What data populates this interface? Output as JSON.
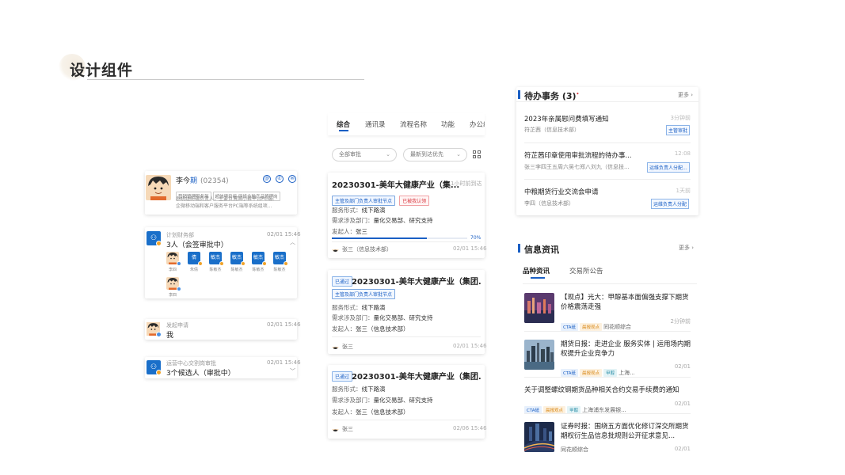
{
  "page": {
    "title": "设计组件"
  },
  "person_card": {
    "name_a": "李今",
    "name_b": "期",
    "code": "(02354)",
    "tags": [
      "营销管理服务部",
      "超体项目组-网络金融产品管理岗"
    ],
    "desc_lines": [
      "系统组前端负责人，主要负责国小君平台PC端、",
      "企微移动端和客户服务平台PC端等系统组项..."
    ],
    "actions": [
      "@",
      "✆",
      "✉"
    ]
  },
  "approvals": [
    {
      "dept": "计划财务部",
      "summary": "3人（会签审批中）",
      "date": "02/01 15:46",
      "members": [
        {
          "initial": "",
          "name": "李四"
        },
        {
          "initial": "倩",
          "name": "朱倩"
        },
        {
          "initial": "敏杰",
          "name": "陈敏杰"
        },
        {
          "initial": "敏杰",
          "name": "陈敏杰"
        },
        {
          "initial": "敏杰",
          "name": "陈敏杰"
        },
        {
          "initial": "敏杰",
          "name": "陈敏杰"
        },
        {
          "initial": "",
          "name": "李四"
        }
      ]
    },
    {
      "dept": "发起申请",
      "summary": "我",
      "date": "02/01 15:46"
    },
    {
      "dept": "运营中心交割岗审批",
      "summary": "3个候选人（审批中）",
      "date": "02/01 15:46"
    }
  ],
  "middle": {
    "tabs": [
      "综合",
      "通讯录",
      "流程名称",
      "功能",
      "办公组"
    ],
    "filters": [
      "全部审批",
      "最新到达优先"
    ],
    "cards": [
      {
        "status": "",
        "title": "20230301-美年大健康产业（集...",
        "time": "1小时前到达",
        "badges": [
          "主管及部门负责人审批节点",
          "已被我认领"
        ],
        "fields": [
          [
            "服务形式：",
            "线下路演"
          ],
          [
            "需求涉及部门：",
            "量化交易部、研究支持"
          ],
          [
            "发起人：",
            "张三"
          ]
        ],
        "progress": 70,
        "progress_label": "70%",
        "footer": "张三（信息技术部）",
        "date": "02/01 15:46"
      },
      {
        "status": "已通过",
        "title": "20230301-美年大健康产业（集团...",
        "badges": [
          "主管及部门负责人审批节点"
        ],
        "fields": [
          [
            "服务形式：",
            "线下路演"
          ],
          [
            "需求涉及部门：",
            "量化交易部、研究支持"
          ],
          [
            "发起人：",
            "张三（信息技术部）"
          ]
        ],
        "footer": "张三",
        "date": "02/01 15:46"
      },
      {
        "status": "已通过",
        "title": "20230301-美年大健康产业（集团...",
        "fields": [
          [
            "服务形式：",
            "线下路演"
          ],
          [
            "需求涉及部门：",
            "量化交易部、研究支持"
          ],
          [
            "发起人：",
            "张三（信息技术部）"
          ]
        ],
        "footer": "张三",
        "date": "02/06 15:46"
      }
    ]
  },
  "todo": {
    "title": "待办事务 (3)",
    "badge": "•",
    "more": "更多",
    "items": [
      {
        "title": "2023年亲属慰问费填写通知",
        "sub": "符芷茜（信息技术部）",
        "time": "3分钟前",
        "tag": "主管审批"
      },
      {
        "title": "符芷茜印章使用审批流程的待办事...",
        "sub": "张三李四王五周六吴七郑八刘九（信息技...",
        "time": "12:08",
        "tag": "运维负责人分配..."
      },
      {
        "title": "中粮期货行业交流会申请",
        "sub": "李四（信息技术部）",
        "time": "1天前",
        "tag": "运维负责人分配"
      }
    ]
  },
  "news": {
    "title": "信息资讯",
    "more": "更多",
    "tabs": [
      "品种资讯",
      "交易所公告"
    ],
    "items": [
      {
        "title": "【观点】光大：甲醇基本面偏强支撑下期货价格震荡走强",
        "tags": [
          [
            "cta",
            "CTA砥"
          ],
          [
            "org",
            "晨报观点"
          ]
        ],
        "source": "同花顺综合",
        "time": "2分钟前"
      },
      {
        "title": "期货日报：走进企业 服务实体 | 运用场内期权提升企业竞争力",
        "tags": [
          [
            "cta",
            "CTA砥"
          ],
          [
            "org",
            "晨报观点"
          ],
          [
            "tl",
            "甲醇"
          ]
        ],
        "source": "上海...",
        "time": "02/01"
      },
      {
        "title": "关于调整螺纹钢期货品种相关合约交易手续费的通知",
        "tags": [
          [
            "cta",
            "CTA砥"
          ],
          [
            "org",
            "晨报观点"
          ],
          [
            "tl",
            "甲醇"
          ]
        ],
        "source": "上海浦东发展银...",
        "time": "02/01"
      },
      {
        "title": "证券时报：围绕五方面优化修订深交所期货期权衍生品信息批规则公开征求意见...",
        "tags": [],
        "source": "同花顺综合",
        "time": "02/01"
      }
    ]
  }
}
